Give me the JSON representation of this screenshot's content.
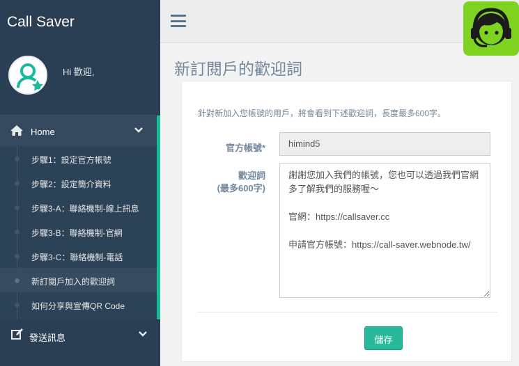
{
  "app": {
    "brand": "Call Saver",
    "greeting": "Hi 歡迎,"
  },
  "sidebar": {
    "home_label": "Home",
    "items": [
      {
        "label": "步驟1：設定官方帳號"
      },
      {
        "label": "步驟2：設定簡介資料"
      },
      {
        "label": "步驟3-A：聯絡機制-線上訊息"
      },
      {
        "label": "步驟3-B：聯絡機制-官網"
      },
      {
        "label": "步驟3-C：聯絡機制-電話"
      },
      {
        "label": "新訂閱戶加入的歡迎詞",
        "active": true
      },
      {
        "label": "如何分享與宣傳QR Code"
      }
    ],
    "send_label": "發送訊息"
  },
  "page": {
    "title": "新訂閱戶的歡迎詞",
    "intro": "針對新加入您帳號的用戶，將會看到下述歡迎詞，長度最多600字。",
    "account_label": "官方帳號*",
    "account_value": "himind5",
    "welcome_label_line1": "歡迎詞",
    "welcome_label_line2": "(最多600字)",
    "welcome_value": "謝謝您加入我們的帳號，您也可以透過我們官網多了解我們的服務喔～\n\n官網：https://callsaver.cc\n\n申請官方帳號：https://call-saver.webnode.tw/",
    "save_label": "儲存"
  },
  "colors": {
    "sidebar": "#2a3f54",
    "accent": "#1abb9c",
    "save": "#26b99a",
    "logo": "#7ed321"
  }
}
